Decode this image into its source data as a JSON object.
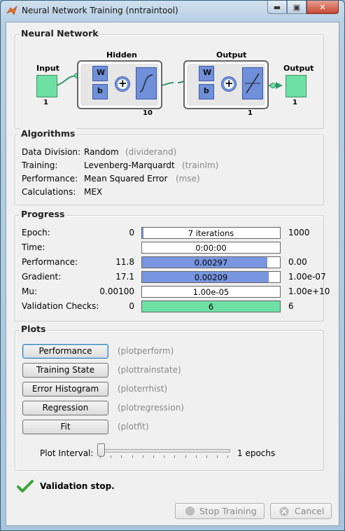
{
  "window": {
    "title": "Neural Network Training (nntraintool)",
    "min": "▬",
    "max": "▣",
    "close": "✕"
  },
  "network": {
    "section": "Neural Network",
    "input_label": "Input",
    "input_size": "1",
    "hidden_label": "Hidden",
    "hidden_size": "10",
    "output_layer_label": "Output",
    "output_layer_size": "1",
    "output_label": "Output",
    "output_size": "1",
    "w": "W",
    "b": "b",
    "plus": "+"
  },
  "algorithms": {
    "section": "Algorithms",
    "rows": [
      {
        "label": "Data Division:",
        "value": "Random",
        "fn": "(dividerand)"
      },
      {
        "label": "Training:",
        "value": "Levenberg-Marquardt",
        "fn": "(trainlm)"
      },
      {
        "label": "Performance:",
        "value": "Mean Squared Error",
        "fn": "(mse)"
      },
      {
        "label": "Calculations:",
        "value": "MEX",
        "fn": ""
      }
    ]
  },
  "progress": {
    "section": "Progress",
    "rows": [
      {
        "label": "Epoch:",
        "start": "0",
        "bar": "7 iterations",
        "end": "1000",
        "fill": 0.0,
        "color": "#6f8fd8"
      },
      {
        "label": "Time:",
        "start": "",
        "bar": "0:00:00",
        "end": "",
        "fill": 0.0,
        "color": "#6f8fd8"
      },
      {
        "label": "Performance:",
        "start": "11.8",
        "bar": "0.00297",
        "end": "0.00",
        "fill": 0.91,
        "color": "#7895e0"
      },
      {
        "label": "Gradient:",
        "start": "17.1",
        "bar": "0.00209",
        "end": "1.00e-07",
        "fill": 0.92,
        "color": "#7895e0"
      },
      {
        "label": "Mu:",
        "start": "0.00100",
        "bar": "1.00e-05",
        "end": "1.00e+10",
        "fill": 0.0,
        "color": "#7895e0"
      },
      {
        "label": "Validation Checks:",
        "start": "0",
        "bar": "6",
        "end": "6",
        "fill": 1.0,
        "color": "#6fe0a4"
      }
    ]
  },
  "plots": {
    "section": "Plots",
    "buttons": [
      {
        "label": "Performance",
        "fn": "(plotperform)"
      },
      {
        "label": "Training State",
        "fn": "(plottrainstate)"
      },
      {
        "label": "Error Histogram",
        "fn": "(ploterrhist)"
      },
      {
        "label": "Regression",
        "fn": "(plotregression)"
      },
      {
        "label": "Fit",
        "fn": "(plotfit)"
      }
    ],
    "interval_label": "Plot Interval:",
    "interval_value": "1 epochs",
    "interval_fraction": 0.0
  },
  "status": {
    "text": "Validation stop."
  },
  "actions": {
    "stop": "Stop Training",
    "cancel": "Cancel"
  }
}
